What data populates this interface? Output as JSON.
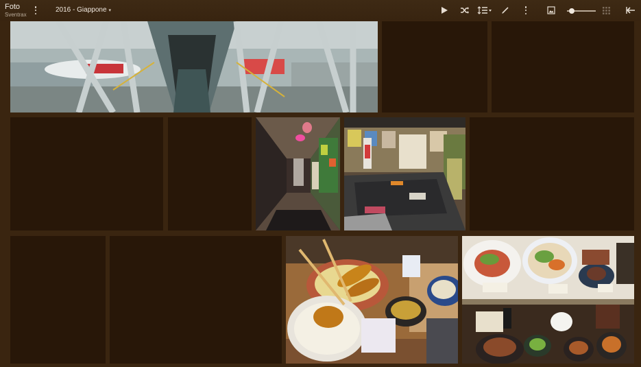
{
  "app": {
    "title": "Foto",
    "user": "Sventrax"
  },
  "album": {
    "name": "2016 - Giappone"
  },
  "toolbar": {
    "icons": [
      "more-vert-icon",
      "play-icon",
      "shuffle-icon",
      "sort-icon",
      "edit-icon",
      "more-vert-icon",
      "image-icon",
      "zoom-slider",
      "grid-icon",
      "back-arrow-icon"
    ]
  },
  "zoom": {
    "level": 0.1
  },
  "gallery": {
    "tiles": [
      {
        "kind": "airport-jet-bridge",
        "loaded": true
      },
      {
        "kind": "placeholder",
        "loaded": false
      },
      {
        "kind": "placeholder",
        "loaded": false
      },
      {
        "kind": "placeholder",
        "loaded": false
      },
      {
        "kind": "placeholder",
        "loaded": false
      },
      {
        "kind": "decorated-hallway",
        "loaded": true
      },
      {
        "kind": "tatami-room",
        "loaded": true
      },
      {
        "kind": "placeholder",
        "loaded": false
      },
      {
        "kind": "placeholder",
        "loaded": false
      },
      {
        "kind": "placeholder",
        "loaded": false
      },
      {
        "kind": "tonkatsu-meal",
        "loaded": true
      },
      {
        "kind": "food-display",
        "loaded": true
      }
    ]
  },
  "colors": {
    "background": "#3a2510",
    "placeholder": "#281708",
    "toolbar_icons": "#e6ddd2"
  }
}
